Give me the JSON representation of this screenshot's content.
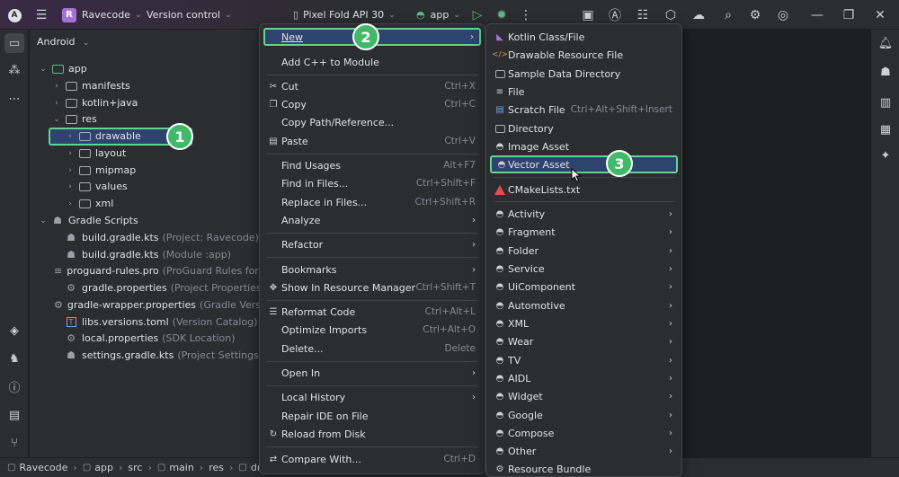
{
  "titlebar": {
    "project_badge": "R",
    "project_name": "Ravecode",
    "vcs": "Version control",
    "device": "Pixel Fold API 30",
    "run_config": "app"
  },
  "project_panel": {
    "header": "Android",
    "tree": [
      {
        "label": "app",
        "hint": ""
      },
      {
        "label": "manifests",
        "hint": ""
      },
      {
        "label": "kotlin+java",
        "hint": ""
      },
      {
        "label": "res",
        "hint": ""
      },
      {
        "label": "drawable",
        "hint": ""
      },
      {
        "label": "layout",
        "hint": ""
      },
      {
        "label": "mipmap",
        "hint": ""
      },
      {
        "label": "values",
        "hint": ""
      },
      {
        "label": "xml",
        "hint": ""
      },
      {
        "label": "Gradle Scripts",
        "hint": ""
      },
      {
        "label": "build.gradle.kts",
        "hint": "(Project: Ravecode)"
      },
      {
        "label": "build.gradle.kts",
        "hint": "(Module :app)"
      },
      {
        "label": "proguard-rules.pro",
        "hint": "(ProGuard Rules for \":a"
      },
      {
        "label": "gradle.properties",
        "hint": "(Project Properties)"
      },
      {
        "label": "gradle-wrapper.properties",
        "hint": "(Gradle Version"
      },
      {
        "label": "libs.versions.toml",
        "hint": "(Version Catalog)"
      },
      {
        "label": "local.properties",
        "hint": "(SDK Location)"
      },
      {
        "label": "settings.gradle.kts",
        "hint": "(Project Settings)"
      }
    ]
  },
  "context_menu": {
    "items": [
      {
        "label": "New",
        "shortcut": ""
      },
      {
        "label": "Add C++ to Module",
        "shortcut": ""
      },
      {
        "label": "Cut",
        "shortcut": "Ctrl+X"
      },
      {
        "label": "Copy",
        "shortcut": "Ctrl+C"
      },
      {
        "label": "Copy Path/Reference...",
        "shortcut": ""
      },
      {
        "label": "Paste",
        "shortcut": "Ctrl+V"
      },
      {
        "label": "Find Usages",
        "shortcut": "Alt+F7"
      },
      {
        "label": "Find in Files...",
        "shortcut": "Ctrl+Shift+F"
      },
      {
        "label": "Replace in Files...",
        "shortcut": "Ctrl+Shift+R"
      },
      {
        "label": "Analyze",
        "shortcut": ""
      },
      {
        "label": "Refactor",
        "shortcut": ""
      },
      {
        "label": "Bookmarks",
        "shortcut": ""
      },
      {
        "label": "Show In Resource Manager",
        "shortcut": "Ctrl+Shift+T"
      },
      {
        "label": "Reformat Code",
        "shortcut": "Ctrl+Alt+L"
      },
      {
        "label": "Optimize Imports",
        "shortcut": "Ctrl+Alt+O"
      },
      {
        "label": "Delete...",
        "shortcut": "Delete"
      },
      {
        "label": "Open In",
        "shortcut": ""
      },
      {
        "label": "Local History",
        "shortcut": ""
      },
      {
        "label": "Repair IDE on File",
        "shortcut": ""
      },
      {
        "label": "Reload from Disk",
        "shortcut": ""
      },
      {
        "label": "Compare With...",
        "shortcut": "Ctrl+D"
      }
    ]
  },
  "new_submenu": {
    "items": [
      {
        "label": "Kotlin Class/File",
        "shortcut": ""
      },
      {
        "label": "Drawable Resource File",
        "shortcut": ""
      },
      {
        "label": "Sample Data Directory",
        "shortcut": ""
      },
      {
        "label": "File",
        "shortcut": ""
      },
      {
        "label": "Scratch File",
        "shortcut": "Ctrl+Alt+Shift+Insert"
      },
      {
        "label": "Directory",
        "shortcut": ""
      },
      {
        "label": "Image Asset",
        "shortcut": ""
      },
      {
        "label": "Vector Asset",
        "shortcut": ""
      },
      {
        "label": "CMakeLists.txt",
        "shortcut": ""
      },
      {
        "label": "Activity",
        "shortcut": ""
      },
      {
        "label": "Fragment",
        "shortcut": ""
      },
      {
        "label": "Folder",
        "shortcut": ""
      },
      {
        "label": "Service",
        "shortcut": ""
      },
      {
        "label": "UiComponent",
        "shortcut": ""
      },
      {
        "label": "Automotive",
        "shortcut": ""
      },
      {
        "label": "XML",
        "shortcut": ""
      },
      {
        "label": "Wear",
        "shortcut": ""
      },
      {
        "label": "TV",
        "shortcut": ""
      },
      {
        "label": "AIDL",
        "shortcut": ""
      },
      {
        "label": "Widget",
        "shortcut": ""
      },
      {
        "label": "Google",
        "shortcut": ""
      },
      {
        "label": "Compose",
        "shortcut": ""
      },
      {
        "label": "Other",
        "shortcut": ""
      },
      {
        "label": "Resource Bundle",
        "shortcut": ""
      }
    ]
  },
  "callouts": [
    "1",
    "2",
    "3"
  ],
  "statusbar": {
    "crumbs": [
      "Ravecode",
      "app",
      "src",
      "main",
      "res",
      "drav"
    ]
  },
  "colors": {
    "accent_green": "#42b96a",
    "selection_blue": "#2e436e",
    "android_green": "#5fb88a"
  }
}
